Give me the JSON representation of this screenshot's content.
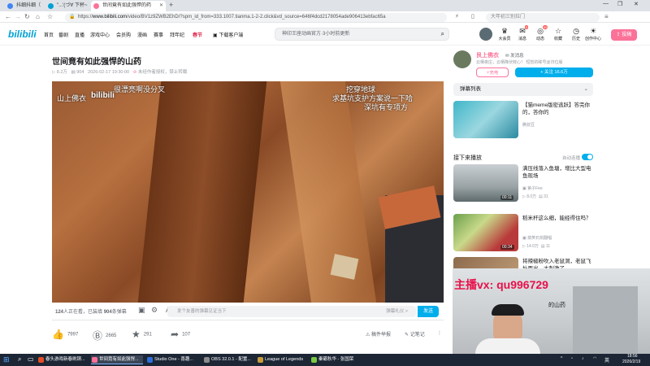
{
  "browser": {
    "tabs": [
      {
        "label": "抖细抖细（",
        "active": false,
        "color": "#4285f4"
      },
      {
        "label": "\"...'(づ∀ 下杯~",
        "active": false,
        "color": "#00a1d6"
      },
      {
        "label": "世间竟有如此强悍的药",
        "active": true,
        "color": "#fb7299"
      }
    ],
    "new_tab": "+",
    "url_prefix": "https://",
    "url_domain": "www.bilibili.com",
    "url_path": "/video/BV1z9ZWB2EhD/?spm_id_from=333.1007.tianma.1-2-2.click&vd_source=646f4dcd2178054ade906413ebfac65a",
    "search_placeholder": "大年初三别拉门",
    "win_controls": [
      "—",
      "❐",
      "✕"
    ]
  },
  "nav": {
    "logo": "bilibili",
    "items": [
      "首页",
      "番剧",
      "直播",
      "游戏中心",
      "会员购",
      "漫画",
      "赛事",
      "拜年纪",
      "春节",
      "下载客户端"
    ],
    "search_placeholder": "神印王座动画官方·3小时前更新",
    "right_icons": [
      {
        "icon": "crown-icon",
        "label": "大会员"
      },
      {
        "icon": "message-icon",
        "label": "消息",
        "badge": "5"
      },
      {
        "icon": "dynamic-icon",
        "label": "动态",
        "badge": "99"
      },
      {
        "icon": "star-icon",
        "label": "收藏"
      },
      {
        "icon": "clock-icon",
        "label": "历史"
      },
      {
        "icon": "bulb-icon",
        "label": "创作中心"
      }
    ],
    "upload_label": "投稿",
    "accent": "#fb7299"
  },
  "video": {
    "title": "世间竟有如此强悍的山药",
    "views": "8.2万",
    "danmaku_count": "904",
    "date": "2026-02-17 19:30:00",
    "copyright": "未经作者授权，禁止转载",
    "watermark": "山上佛衣",
    "overlays": [
      "很漂亮啊没分叉",
      "挖穿地球",
      "求基坑支护方案说一下哈",
      "深坑有专项方",
      "bilibili"
    ]
  },
  "player_bar": {
    "online": "124",
    "online_suffix": "人正在看，已装填",
    "danmu": "904",
    "danmu_suffix": "条弹幕",
    "input_placeholder": "发个友善的弹幕见证当下",
    "etiquette": "弹幕礼仪 >",
    "send": "发送"
  },
  "actions": {
    "like": "7997",
    "coin": "2665",
    "fav": "291",
    "share": "107",
    "report": "稿件举报",
    "notes": "记笔记",
    "more": "⋮"
  },
  "uploader": {
    "name": "艮上佛衣",
    "message": "发消息",
    "desc": "云栖夜庄，云栖降伏鲜心！ 短暂的眸号@归位版",
    "charge": "充电",
    "follow": "+ 关注 16.6万"
  },
  "sidebar": {
    "danmu_list": "弹幕列表",
    "up_next": "接下来播放",
    "autoplay": "自动连播",
    "ad": {
      "title": "【猫meme版密逃跃】答完你的，答你的",
      "author": "腾叔豆"
    },
    "recs": [
      {
        "title": "满压线落入鱼塘，增比大型电鱼现场",
        "author": "第子Fee",
        "views": "8.0万",
        "comments": "31",
        "duration": "00:11"
      },
      {
        "title": "稻米杆这么细，能经得住吗？",
        "author": "搞笑石刻翻唱",
        "views": "14.0万",
        "comments": "11",
        "duration": "00:34"
      },
      {
        "title": "将辣椒粉吹入老鼠洞，老鼠飞扑而出，太刺激了",
        "author": "农场",
        "views": "",
        "comments": "",
        "duration": ""
      }
    ],
    "overlay_partial": "的山药"
  },
  "webcam": {
    "text": "主播vx: qu996729"
  },
  "taskbar": {
    "apps": [
      {
        "label": "春头游戏新春刷铜...",
        "color": "#e44d26"
      },
      {
        "label": "世间竟有如此强悍...",
        "color": "#fb7299",
        "active": true
      },
      {
        "label": "Studio One - 喜趣...",
        "color": "#2e6fd8"
      },
      {
        "label": "OBS 32.0.1 - 配置...",
        "color": "#302e31"
      },
      {
        "label": "League of Legends",
        "color": "#c89b3c"
      },
      {
        "label": "秦霸秋华 - 张国荣",
        "color": "#7ac943"
      }
    ],
    "tray_lang": "英",
    "time": "18:56",
    "date": "2026/2/19"
  }
}
